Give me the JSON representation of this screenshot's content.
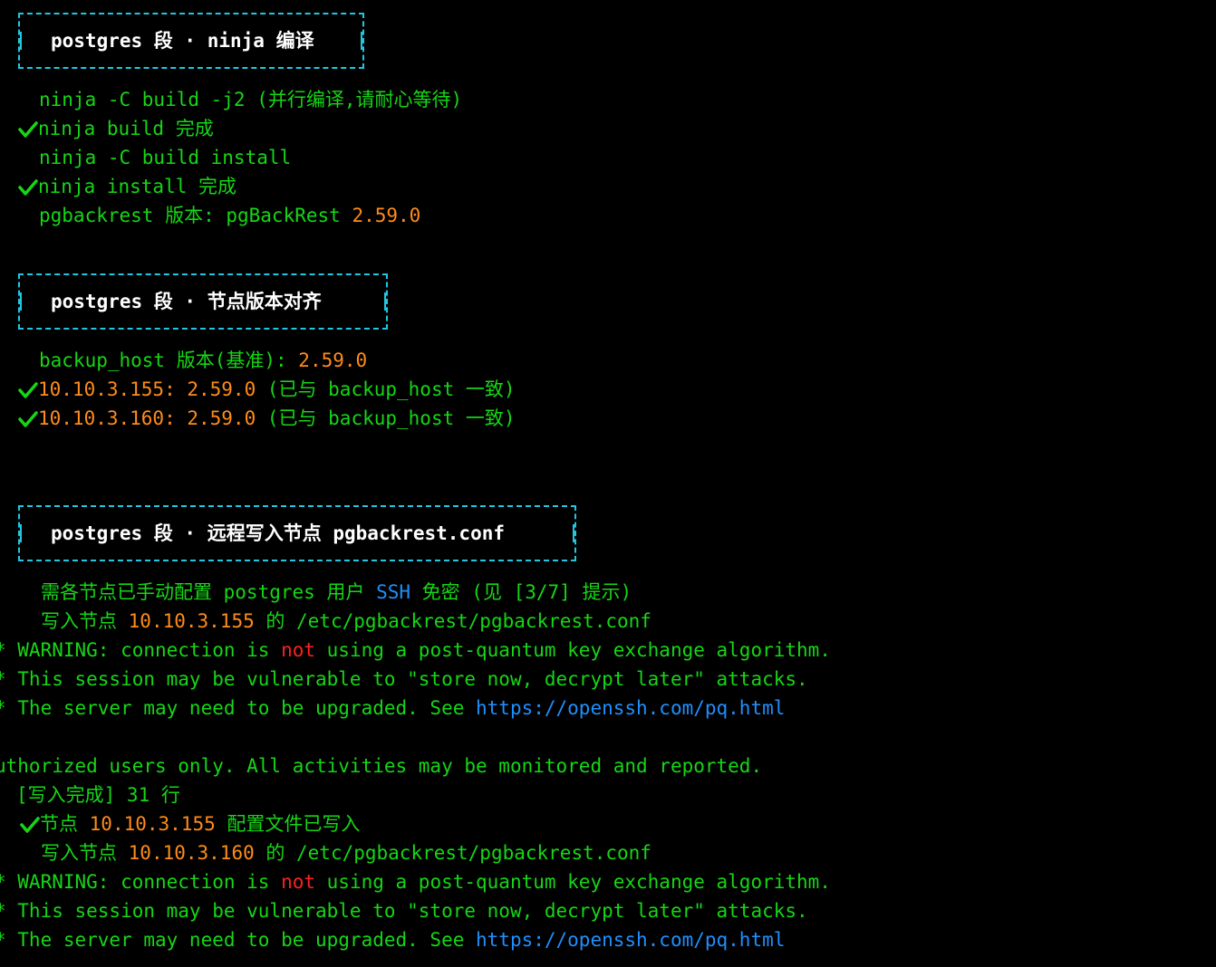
{
  "colors": {
    "background": "#000000",
    "green": "#16d616",
    "orange": "#ff8c1a",
    "red": "#ff2020",
    "blue": "#1e90ff",
    "white": "#ffffff",
    "cyan_border": "#1fc8e0"
  },
  "sections": [
    {
      "title": "postgres 段 · ninja 编译"
    },
    {
      "title": "postgres 段 · 节点版本对齐"
    },
    {
      "title": "postgres 段 · 远程写入节点 pgbackrest.conf"
    }
  ],
  "lines": {
    "l1": "ninja -C build -j2 (并行编译,请耐心等待)",
    "l2": "ninja build 完成",
    "l3": "ninja -C build install",
    "l4": "ninja install 完成",
    "l5a": "pgbackrest 版本: pgBackRest ",
    "l5b": "2.59.0",
    "l6a": "backup_host 版本(基准): ",
    "l6b": "2.59.0",
    "l7a": "10.10.3.155: 2.59.0 ",
    "l7b": "(已与 backup_host 一致)",
    "l8a": "10.10.3.160: 2.59.0 ",
    "l8b": "(已与 backup_host 一致)",
    "l9a": "需各节点已手动配置 postgres 用户 ",
    "l9b": "SSH",
    "l9c": " 免密 (见 [3/7] 提示)",
    "l10a": "写入节点 ",
    "l10b": "10.10.3.155",
    "l10c": " 的 /etc/pgbackrest/pgbackrest.conf",
    "w1a": "* WARNING: connection is ",
    "w1b": "not",
    "w1c": " using a post-quantum key exchange algorithm.",
    "w2": "* This session may be vulnerable to \"store now, decrypt later\" attacks.",
    "w3a": "* The server may need to be upgraded. See ",
    "w3b": "https://openssh.com/pq.html",
    "auth": "uthorized users only. All activities may be monitored and reported.",
    "done": "[写入完成] 31 行",
    "n1a": "节点 ",
    "n1b": "10.10.3.155",
    "n1c": " 配置文件已写入",
    "l11a": "写入节点 ",
    "l11b": "10.10.3.160",
    "l11c": " 的 /etc/pgbackrest/pgbackrest.conf",
    "w4a": "* WARNING: connection is ",
    "w4b": "not",
    "w4c": " using a post-quantum key exchange algorithm.",
    "w5": "* This session may be vulnerable to \"store now, decrypt later\" attacks.",
    "w6a": "* The server may need to be upgraded. See ",
    "w6b": "https://openssh.com/pq.html"
  },
  "icons": {
    "check": "check-icon"
  }
}
